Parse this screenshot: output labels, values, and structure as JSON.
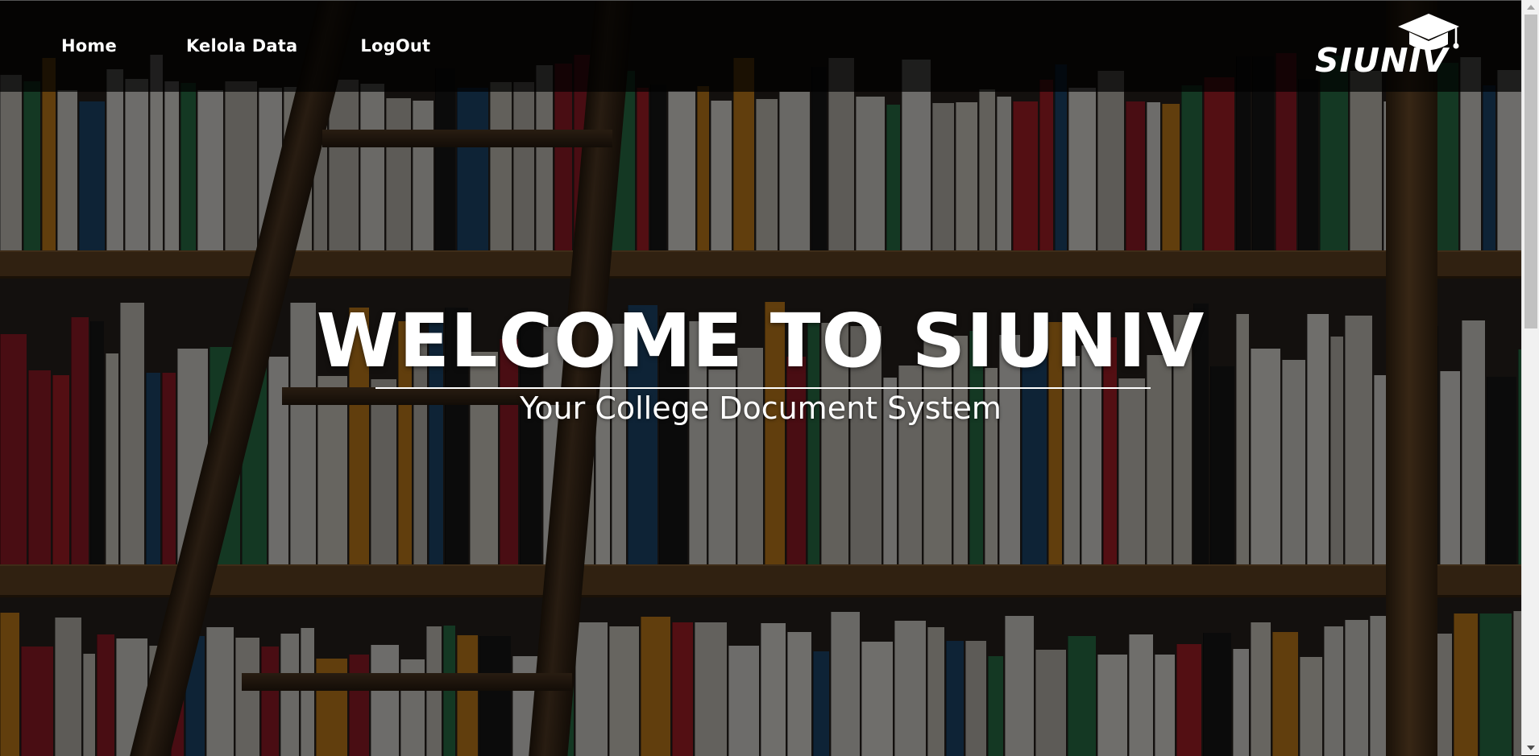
{
  "nav": {
    "items": [
      {
        "label": "Home"
      },
      {
        "label": "Kelola Data"
      },
      {
        "label": "LogOut"
      }
    ]
  },
  "brand": {
    "name": "SIUNIV",
    "icon": "graduation-cap-icon"
  },
  "hero": {
    "title": "WELCOME TO SIUNIV",
    "subtitle": "Your College Document System"
  },
  "background": {
    "image": "bookshelf-with-ladder",
    "overlay_color": "#000000"
  },
  "colors": {
    "text": "#ffffff",
    "navbar_bg": "#000000",
    "scrollbar_track": "#f1f1f1",
    "scrollbar_thumb": "#c1c1c1"
  }
}
